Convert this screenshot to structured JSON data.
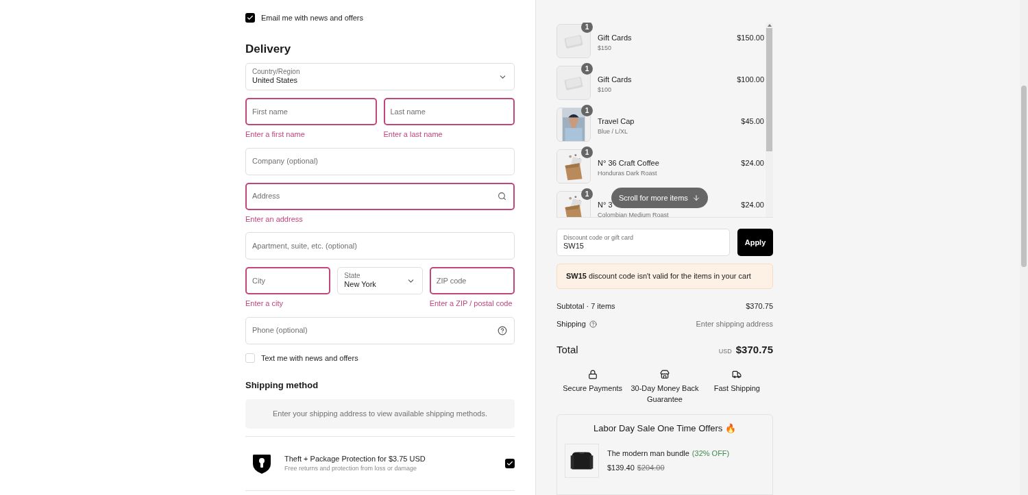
{
  "newsletter": {
    "label": "Email me with news and offers",
    "checked": true
  },
  "delivery": {
    "heading": "Delivery",
    "rows": [
      [
        {
          "kind": "select",
          "label": "Country/Region",
          "value": "United States",
          "invalid": false
        }
      ],
      [
        {
          "kind": "text",
          "placeholder": "First name",
          "invalid": true,
          "error": "Enter a first name"
        },
        {
          "kind": "text",
          "placeholder": "Last name",
          "invalid": true,
          "error": "Enter a last name"
        }
      ],
      [
        {
          "kind": "text",
          "placeholder": "Company (optional)",
          "invalid": false
        }
      ],
      [
        {
          "kind": "search",
          "placeholder": "Address",
          "invalid": true,
          "error": "Enter an address"
        }
      ],
      [
        {
          "kind": "text",
          "placeholder": "Apartment, suite, etc. (optional)",
          "invalid": false
        }
      ],
      [
        {
          "kind": "text",
          "placeholder": "City",
          "invalid": true,
          "error": "Enter a city"
        },
        {
          "kind": "select",
          "label": "State",
          "value": "New York",
          "invalid": false
        },
        {
          "kind": "text",
          "placeholder": "ZIP code",
          "invalid": true,
          "error": "Enter a ZIP / postal code"
        }
      ],
      [
        {
          "kind": "help",
          "placeholder": "Phone (optional)",
          "invalid": false
        }
      ]
    ],
    "sms": {
      "label": "Text me with news and offers",
      "checked": false
    }
  },
  "shipping_method": {
    "heading": "Shipping method",
    "notice": "Enter your shipping address to view available shipping methods."
  },
  "protection": {
    "title": "Theft + Package Protection for $3.75 USD",
    "subtitle": "Free returns and protection from loss or damage",
    "checked": true
  },
  "cart": {
    "items": [
      {
        "quantity": "1",
        "name": "Gift Cards",
        "variant": "$150",
        "price": "$150.00"
      },
      {
        "quantity": "1",
        "name": "Gift Cards",
        "variant": "$100",
        "price": "$100.00"
      },
      {
        "quantity": "1",
        "name": "Travel Cap",
        "variant": "Blue / L/XL",
        "price": "$45.00"
      },
      {
        "quantity": "1",
        "name": "N° 36 Craft Coffee",
        "variant": "Honduras Dark Roast",
        "price": "$24.00"
      },
      {
        "quantity": "1",
        "name": "N° 3",
        "variant": "Colombian Medium Roast",
        "price": "$24.00"
      }
    ],
    "scroll_hint": "Scroll for more items"
  },
  "discount": {
    "label": "Discount code or gift card",
    "value": "SW15",
    "button": "Apply",
    "message": "**SW15** discount code isn't valid for the items in your cart"
  },
  "summary": {
    "subtotal_label": "Subtotal · 7 items",
    "subtotal": "$370.75",
    "shipping_label": "Shipping",
    "shipping": "Enter shipping address",
    "total_label": "Total",
    "currency": "USD",
    "total": "$370.75"
  },
  "badges": [
    {
      "kind": "lock",
      "label": "Secure Payments"
    },
    {
      "kind": "store",
      "label": "30-Day Money Back Guarantee"
    },
    {
      "kind": "truck",
      "label": "Fast Shipping"
    }
  ],
  "offers": {
    "title": "Labor Day Sale One Time Offers 🔥",
    "items": [
      {
        "name": "The modern man bundle",
        "discount": "(32% OFF)",
        "price": "$139.40",
        "original_price": "$204.00"
      }
    ]
  }
}
